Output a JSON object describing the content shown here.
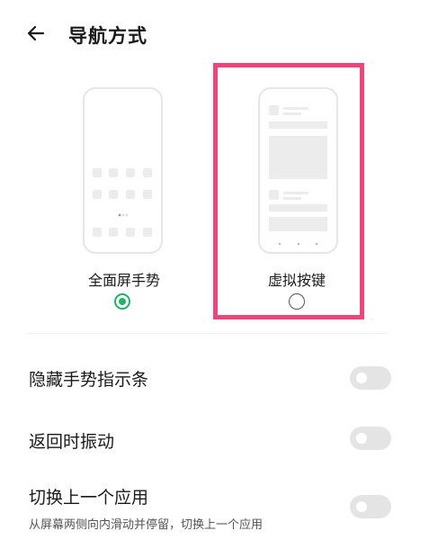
{
  "header": {
    "back_icon": "arrow-left-icon",
    "title": "导航方式"
  },
  "options": [
    {
      "label": "全面屏手势",
      "selected": true
    },
    {
      "label": "虚拟按键",
      "selected": false
    }
  ],
  "settings": [
    {
      "label": "隐藏手势指示条",
      "subtitle": "",
      "enabled": false
    },
    {
      "label": "返回时振动",
      "subtitle": "",
      "enabled": false
    },
    {
      "label": "切换上一个应用",
      "subtitle": "从屏幕两侧向内滑动并停留，切换上一个应用",
      "enabled": false
    }
  ],
  "colors": {
    "accent": "#22b26a",
    "highlight": "#f0457a",
    "toggle_off": "#e4e4e4"
  }
}
